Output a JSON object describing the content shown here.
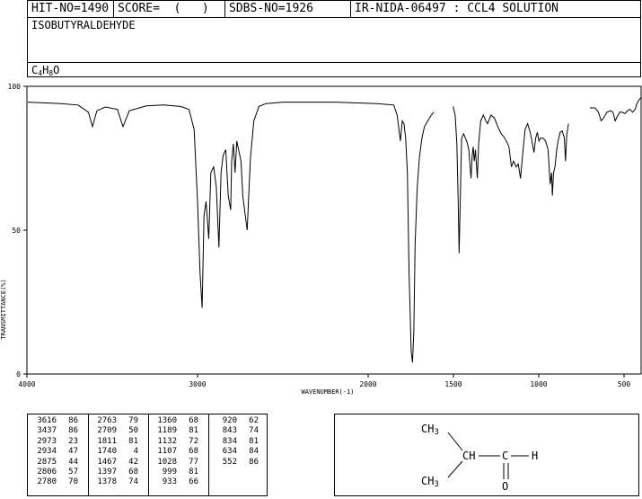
{
  "header": {
    "hit_no": "HIT-NO=1490",
    "score": "SCORE=  (   )",
    "sdbs_no": "SDBS-NO=1926",
    "ir_nida": "IR-NIDA-06497 : CCL4 SOLUTION",
    "compound_name": "ISOBUTYRALDEHYDE",
    "formula_c": "C",
    "formula_c_sub": "4",
    "formula_h": "H",
    "formula_h_sub": "8",
    "formula_o": "O"
  },
  "chart_data": {
    "type": "line",
    "xlabel": "WAVENUMBER(-1)",
    "ylabel": "TRANSMITTANCE(%)",
    "xlim": [
      4000,
      400
    ],
    "ylim": [
      0,
      100
    ],
    "x_ticks": [
      4000,
      3000,
      2000,
      1500,
      1000,
      500
    ],
    "y_ticks": [
      0,
      50,
      100
    ],
    "grid": false,
    "segments": [
      [
        [
          3995,
          94.5
        ],
        [
          3800,
          94
        ],
        [
          3700,
          93.5
        ],
        [
          3640,
          91
        ],
        [
          3616,
          86
        ],
        [
          3590,
          91.5
        ],
        [
          3540,
          92.8
        ],
        [
          3470,
          92
        ],
        [
          3437,
          86
        ],
        [
          3400,
          91.5
        ],
        [
          3300,
          93.2
        ],
        [
          3200,
          93.5
        ],
        [
          3100,
          93
        ],
        [
          3050,
          92
        ],
        [
          3020,
          85
        ],
        [
          3000,
          60
        ],
        [
          2985,
          35
        ],
        [
          2973,
          23
        ],
        [
          2962,
          55
        ],
        [
          2950,
          60
        ],
        [
          2934,
          47
        ],
        [
          2922,
          70
        ],
        [
          2905,
          72
        ],
        [
          2890,
          65
        ],
        [
          2875,
          44
        ],
        [
          2862,
          70
        ],
        [
          2850,
          76
        ],
        [
          2835,
          78
        ],
        [
          2820,
          62
        ],
        [
          2806,
          57
        ],
        [
          2800,
          74
        ],
        [
          2790,
          80
        ],
        [
          2780,
          70
        ],
        [
          2770,
          81
        ],
        [
          2763,
          79
        ],
        [
          2745,
          74
        ],
        [
          2735,
          62
        ],
        [
          2720,
          55
        ],
        [
          2709,
          50
        ],
        [
          2700,
          62
        ],
        [
          2690,
          75
        ],
        [
          2670,
          88
        ],
        [
          2640,
          93
        ],
        [
          2600,
          94
        ],
        [
          2500,
          94.5
        ],
        [
          2200,
          94.5
        ],
        [
          1950,
          94
        ],
        [
          1850,
          93.5
        ],
        [
          1830,
          90
        ],
        [
          1811,
          81
        ],
        [
          1800,
          88
        ],
        [
          1790,
          87
        ],
        [
          1780,
          82
        ],
        [
          1770,
          70
        ],
        [
          1760,
          35
        ],
        [
          1748,
          8
        ],
        [
          1740,
          4
        ],
        [
          1732,
          15
        ],
        [
          1725,
          45
        ],
        [
          1712,
          65
        ],
        [
          1700,
          75
        ],
        [
          1685,
          82
        ],
        [
          1670,
          86
        ],
        [
          1650,
          88
        ],
        [
          1630,
          90
        ],
        [
          1615,
          91
        ]
      ],
      [
        [
          1502,
          93
        ],
        [
          1490,
          90
        ],
        [
          1480,
          80
        ],
        [
          1472,
          60
        ],
        [
          1467,
          42
        ],
        [
          1460,
          60
        ],
        [
          1452,
          82
        ],
        [
          1440,
          83.5
        ],
        [
          1430,
          82
        ],
        [
          1420,
          80.5
        ],
        [
          1410,
          78
        ],
        [
          1397,
          68
        ],
        [
          1390,
          76
        ],
        [
          1384,
          79
        ],
        [
          1378,
          74
        ],
        [
          1371,
          78
        ],
        [
          1360,
          68
        ],
        [
          1352,
          80
        ],
        [
          1340,
          88
        ],
        [
          1325,
          90
        ],
        [
          1310,
          88
        ],
        [
          1300,
          87
        ],
        [
          1280,
          90
        ],
        [
          1260,
          89
        ],
        [
          1240,
          86
        ],
        [
          1220,
          83.5
        ],
        [
          1205,
          82.5
        ],
        [
          1190,
          81
        ],
        [
          1175,
          79
        ],
        [
          1160,
          72
        ],
        [
          1148,
          74
        ],
        [
          1132,
          72
        ],
        [
          1120,
          73
        ],
        [
          1107,
          68
        ],
        [
          1095,
          76
        ],
        [
          1080,
          85
        ],
        [
          1065,
          87
        ],
        [
          1050,
          84
        ],
        [
          1040,
          81
        ],
        [
          1028,
          77
        ],
        [
          1018,
          82
        ],
        [
          1008,
          84
        ],
        [
          999,
          81
        ],
        [
          990,
          82
        ],
        [
          975,
          82
        ],
        [
          960,
          81
        ],
        [
          945,
          78
        ],
        [
          933,
          66
        ],
        [
          925,
          70
        ],
        [
          920,
          62
        ],
        [
          913,
          70
        ],
        [
          905,
          72
        ],
        [
          895,
          78
        ],
        [
          885,
          81.5
        ],
        [
          875,
          84
        ],
        [
          862,
          84.5
        ],
        [
          850,
          82
        ],
        [
          843,
          74
        ],
        [
          836,
          83
        ],
        [
          826,
          87
        ]
      ],
      [
        [
          700,
          92.5
        ],
        [
          670,
          92.5
        ],
        [
          650,
          91
        ],
        [
          634,
          88
        ],
        [
          620,
          89
        ],
        [
          600,
          91
        ],
        [
          580,
          91.5
        ],
        [
          565,
          91
        ],
        [
          552,
          88
        ],
        [
          540,
          89.5
        ],
        [
          525,
          91
        ],
        [
          510,
          91
        ],
        [
          495,
          90.5
        ],
        [
          480,
          91.5
        ],
        [
          465,
          92
        ],
        [
          450,
          91
        ],
        [
          435,
          92
        ],
        [
          425,
          94
        ],
        [
          415,
          95
        ],
        [
          405,
          95.8
        ],
        [
          402,
          96
        ]
      ]
    ]
  },
  "peaks": {
    "columns": [
      [
        [
          3616,
          86
        ],
        [
          3437,
          86
        ],
        [
          2973,
          23
        ],
        [
          2934,
          47
        ],
        [
          2875,
          44
        ],
        [
          2806,
          57
        ],
        [
          2780,
          70
        ]
      ],
      [
        [
          2763,
          79
        ],
        [
          2709,
          50
        ],
        [
          1811,
          81
        ],
        [
          1740,
          4
        ],
        [
          1467,
          42
        ],
        [
          1397,
          68
        ],
        [
          1378,
          74
        ]
      ],
      [
        [
          1360,
          68
        ],
        [
          1189,
          81
        ],
        [
          1132,
          72
        ],
        [
          1107,
          68
        ],
        [
          1028,
          77
        ],
        [
          999,
          81
        ],
        [
          933,
          66
        ]
      ],
      [
        [
          920,
          62
        ],
        [
          843,
          74
        ],
        [
          834,
          81
        ],
        [
          634,
          84
        ],
        [
          552,
          86
        ]
      ]
    ]
  },
  "structure": {
    "ch3_top": "CH",
    "ch3_top_sub": "3",
    "ch": "CH",
    "c": "C",
    "h": "H",
    "o": "O",
    "ch3_bottom": "CH",
    "ch3_bottom_sub": "3"
  }
}
